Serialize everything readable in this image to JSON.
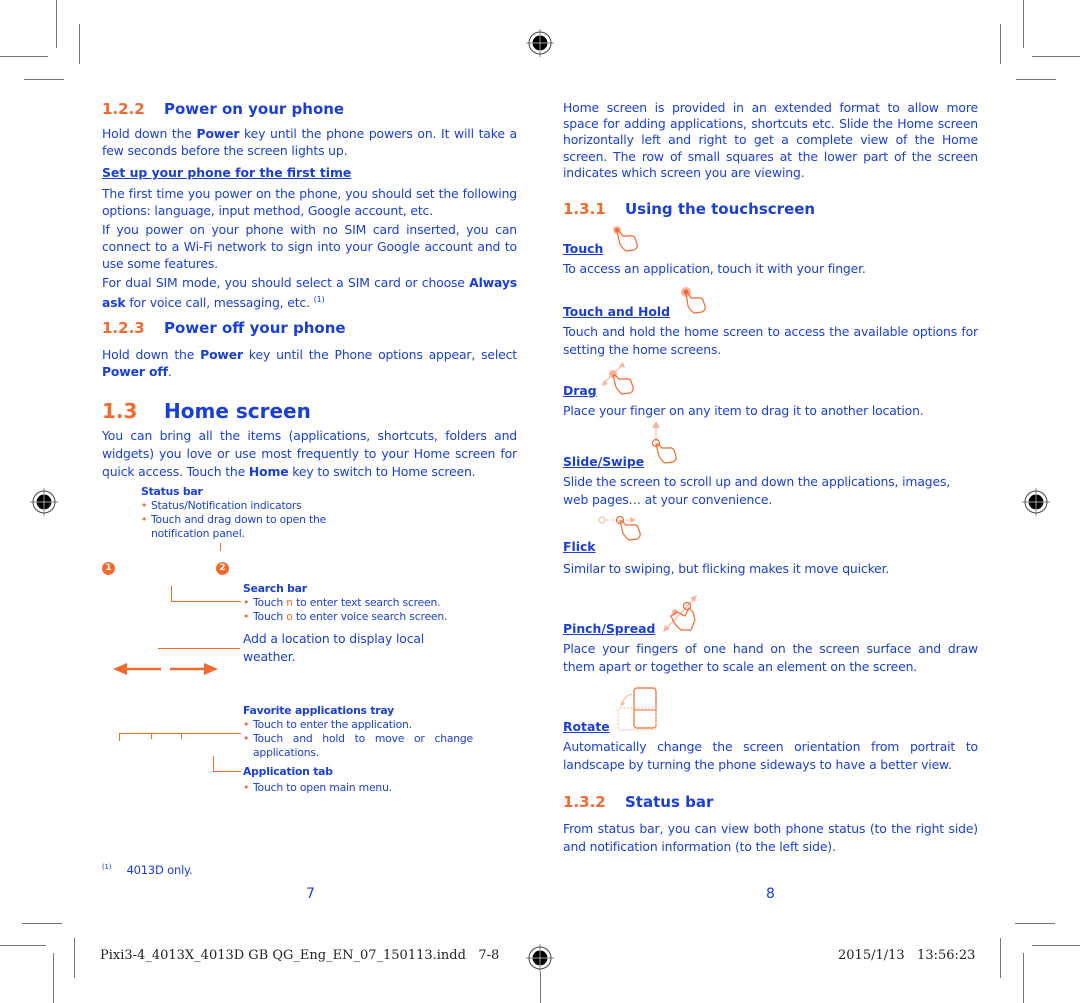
{
  "left_page": {
    "sec_122": {
      "num": "1.2.2",
      "title": "Power on your phone"
    },
    "p1": {
      "a": "Hold down the ",
      "b": "Power",
      "c": " key until the phone powers on. It will take a few seconds before the screen lights up."
    },
    "setup_link": "Set up your phone for the first time",
    "p2": "The first time you power on the phone, you should set the following options: language, input method, Google account, etc.",
    "p3": "If you power on your phone with no SIM card inserted, you can connect to a Wi-Fi network to sign into your Google account and to use some features.",
    "p4": {
      "a": "For dual SIM mode, you should select a SIM card or choose ",
      "b": "Always ask",
      "c": " for voice call, messaging, etc. ",
      "sup": "(1)"
    },
    "sec_123": {
      "num": "1.2.3",
      "title": "Power off your phone"
    },
    "p5": {
      "a": "Hold down the ",
      "b": "Power",
      "c": " key until the Phone options appear, select ",
      "d": "Power off",
      "e": "."
    },
    "sec_13": {
      "num": "1.3",
      "title": "Home screen"
    },
    "p6": {
      "a": "You can bring all the items (applications, shortcuts, folders and widgets) you love or use most frequently to your Home screen for quick access. Touch the ",
      "b": "Home",
      "c": " key to switch to Home screen."
    },
    "diagram": {
      "status_bar": {
        "title": "Status bar",
        "items": [
          "Status/Notification indicators",
          "Touch and drag down to open the notification panel."
        ]
      },
      "badge1": "1",
      "badge2": "2",
      "search_bar": {
        "title": "Search bar",
        "items": [
          {
            "a": "Touch ",
            "icon": "n",
            "b": " to enter text search screen."
          },
          {
            "a": "Touch ",
            "icon": "o",
            "b": " to enter voice search screen."
          }
        ]
      },
      "weather": "Add a location to display local weather.",
      "favorites": {
        "title": "Favorite applications tray",
        "items": [
          "Touch to enter the application.",
          "Touch and hold to move or change applications."
        ]
      },
      "app_tab": {
        "title": "Application tab",
        "items": [
          "Touch to open main menu."
        ]
      }
    },
    "footnote": {
      "mark": "(1)",
      "text": "4013D only."
    },
    "page_number": "7"
  },
  "right_page": {
    "intro": "Home screen is provided in an extended format to allow more space for adding applications, shortcuts etc. Slide the Home screen horizontally left and right to get a complete view of the Home screen. The row of small squares at the lower part of the screen indicates which screen you are viewing.",
    "sec_131": {
      "num": "1.3.1",
      "title": "Using the touchscreen"
    },
    "gestures": [
      {
        "name": "Touch",
        "icon": "touch-gesture-icon",
        "desc": "To access an application, touch it with your finger."
      },
      {
        "name": "Touch and Hold",
        "icon": "touch-hold-gesture-icon",
        "desc": "Touch and hold the home screen to access the available options for setting the home screens."
      },
      {
        "name": "Drag",
        "icon": "drag-gesture-icon",
        "desc": "Place your finger on any item to drag it to another location."
      },
      {
        "name": "Slide/Swipe",
        "icon": "swipe-gesture-icon",
        "desc": "Slide the screen to scroll up and down the applications, images, web pages… at your convenience."
      },
      {
        "name": "Flick",
        "icon": "flick-gesture-icon",
        "desc": "Similar to swiping, but flicking makes it move quicker."
      },
      {
        "name": "Pinch/Spread",
        "icon": "pinch-gesture-icon",
        "desc": "Place your fingers of one hand on the screen surface and draw them apart or together to scale an element on the screen."
      },
      {
        "name": "Rotate",
        "icon": "rotate-gesture-icon",
        "desc": "Automatically change the screen orientation from portrait to landscape by turning the phone sideways to have a better view."
      }
    ],
    "sec_132": {
      "num": "1.3.2",
      "title": "Status bar"
    },
    "status_desc": "From status bar, you can view both phone status (to the right side) and notification information (to the left side).",
    "page_number": "8"
  },
  "print_footer": {
    "file": "Pixi3-4_4013X_4013D GB QG_Eng_EN_07_150113.indd   7-8",
    "timestamp": "2015/1/13   13:56:23"
  },
  "colors": {
    "accent_orange": "#f26a2e",
    "text_blue": "#1a3fd6"
  }
}
